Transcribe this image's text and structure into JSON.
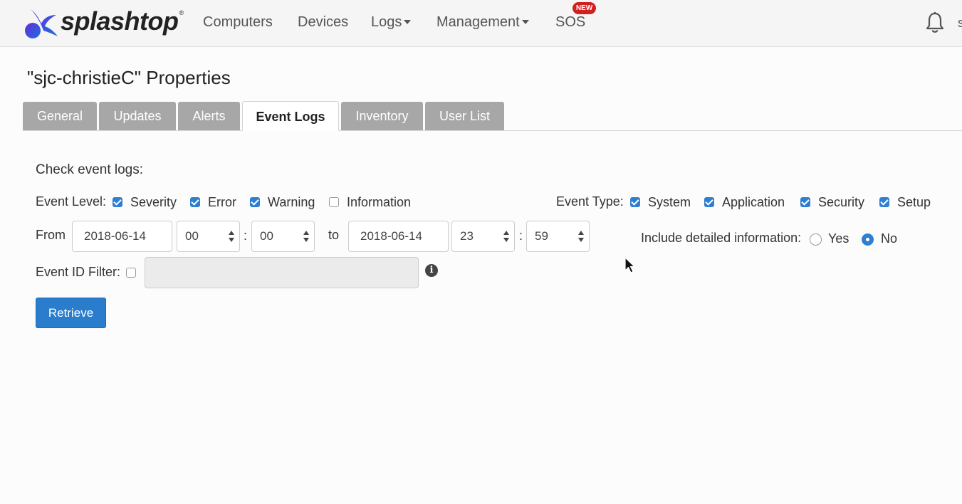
{
  "brand": {
    "name": "splashtop",
    "reg": "®"
  },
  "nav": {
    "items": [
      {
        "label": "Computers",
        "has_caret": false
      },
      {
        "label": "Devices",
        "has_caret": false
      },
      {
        "label": "Logs",
        "has_caret": true
      },
      {
        "label": "Management",
        "has_caret": true
      },
      {
        "label": "SOS",
        "has_caret": false,
        "badge": "NEW"
      }
    ],
    "bell_icon": "bell-icon",
    "cut_letter": "s"
  },
  "page_title": "\"sjc-christieC\" Properties",
  "tabs": [
    {
      "label": "General",
      "active": false
    },
    {
      "label": "Updates",
      "active": false
    },
    {
      "label": "Alerts",
      "active": false
    },
    {
      "label": "Event Logs",
      "active": true
    },
    {
      "label": "Inventory",
      "active": false
    },
    {
      "label": "User List",
      "active": false
    }
  ],
  "form": {
    "heading": "Check event logs:",
    "event_level": {
      "label": "Event Level:",
      "options": [
        {
          "label": "Severity",
          "checked": true
        },
        {
          "label": "Error",
          "checked": true
        },
        {
          "label": "Warning",
          "checked": true
        },
        {
          "label": "Information",
          "checked": false
        }
      ]
    },
    "event_type": {
      "label": "Event Type:",
      "options": [
        {
          "label": "System",
          "checked": true
        },
        {
          "label": "Application",
          "checked": true
        },
        {
          "label": "Security",
          "checked": true
        },
        {
          "label": "Setup",
          "checked": true
        }
      ]
    },
    "from_label": "From",
    "from_date": "2018-06-14",
    "from_hour": "00",
    "from_minute": "00",
    "to_label": "to",
    "to_date": "2018-06-14",
    "to_hour": "23",
    "to_minute": "59",
    "time_sep": ":",
    "detailed": {
      "label": "Include detailed information:",
      "yes": "Yes",
      "no": "No",
      "selected": "No"
    },
    "event_id_filter": {
      "label": "Event ID Filter:",
      "checked": false,
      "value": ""
    },
    "info_icon": "info-icon",
    "retrieve_label": "Retrieve"
  },
  "colors": {
    "accent": "#2e7fd1",
    "badge": "#d0201f",
    "tab_inactive": "#a7a7a7"
  }
}
